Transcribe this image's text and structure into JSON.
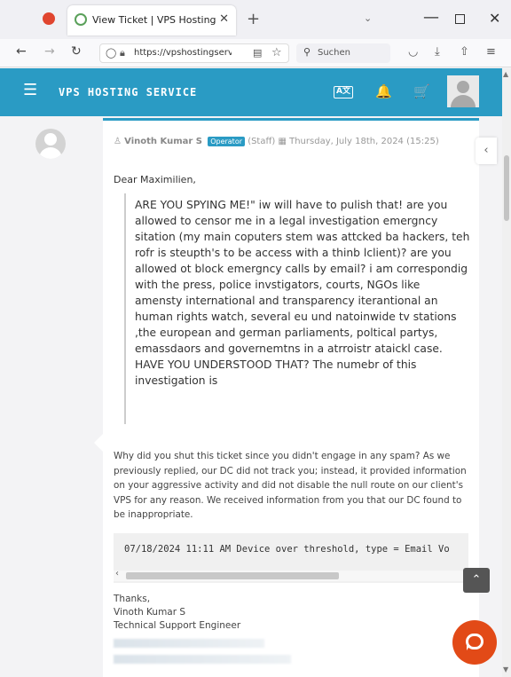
{
  "browser": {
    "tab_title": "View Ticket | VPS Hosting Servic",
    "tab_close": "✕",
    "new_tab": "+",
    "tab_list": "⌄",
    "url": "https://vpshostingserv",
    "search_placeholder": "Suchen",
    "window_min": "—",
    "window_close": "✕"
  },
  "site": {
    "title": "VPS HOSTING SERVICE",
    "translate_label": "A文",
    "accent_color": "#2a9bc4"
  },
  "message": {
    "author": "Vinoth Kumar S",
    "role": "Operator",
    "staff_label": "(Staff)",
    "date": "Thursday, July 18th, 2024 (15:25)",
    "greeting": "Dear Maximilien,",
    "quote": "ARE YOU SPYING ME!\" iw will have to pulish that! are you allowed to censor me in a legal investigation emergncy sitation (my main coputers stem was attcked ba hackers, teh rofr is steupth's to be access with a thinb lclient)? are you allowed ot block emergncy calls by email? i am correspondig with the press, police invstigators, courts, NGOs like amensty international and transparency iterantional an human rights watch, several eu und natoinwide tv stations ,the european and german parliaments, poltical partys, emassdaors and governemtns in a atrroistr ataickl case. HAVE YOU UNDERSTOOD THAT? The numebr of this investigation is",
    "reply": "Why did you shut this ticket since you didn't engage in any spam? As we previously replied, our DC did not track you; instead, it provided information on your aggressive activity and did not disable the null route on our client's VPS for any reason. We received information from you that our DC found to be inappropriate.",
    "code": "07/18/2024 11:11 AM Device over threshold, type = Email Vo",
    "signature": {
      "thanks": "Thanks,",
      "name": "Vinoth Kumar S",
      "title": "Technical Support Engineer"
    }
  },
  "icons": {
    "menu": "☰",
    "bell": "🔔",
    "cart": "🛒",
    "collapse": "‹",
    "to_top": "⌃"
  }
}
